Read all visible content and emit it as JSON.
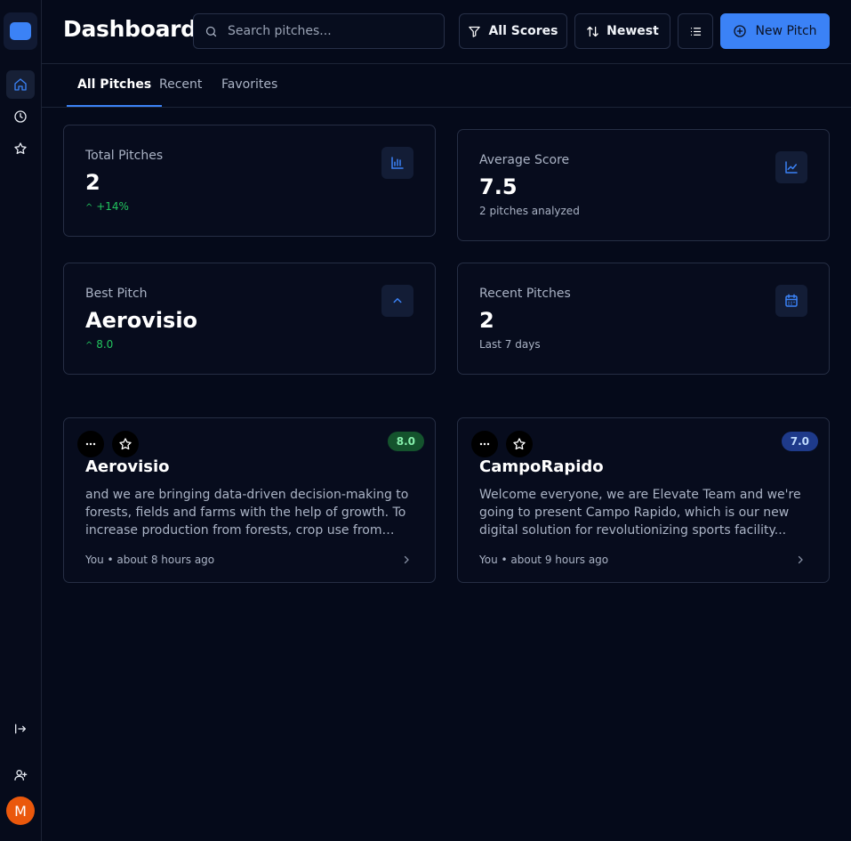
{
  "app": {
    "avatar_initial": "M"
  },
  "header": {
    "title": "Dashboard",
    "search_placeholder": "Search pitches...",
    "filter_label": "All Scores",
    "sort_label": "Newest",
    "new_pitch_label": "New Pitch"
  },
  "tabs": [
    {
      "label": "All Pitches",
      "active": true
    },
    {
      "label": "Recent",
      "active": false
    },
    {
      "label": "Favorites",
      "active": false
    }
  ],
  "stats": {
    "total": {
      "label": "Total Pitches",
      "value": "2",
      "sub": "+14%",
      "icon": "bar-chart-icon"
    },
    "average": {
      "label": "Average Score",
      "value": "7.5",
      "sub": "2 pitches analyzed",
      "icon": "line-chart-icon"
    },
    "best": {
      "label": "Best Pitch",
      "value": "Aerovisio",
      "sub": "8.0",
      "icon": "chevron-up-icon"
    },
    "recent": {
      "label": "Recent Pitches",
      "value": "2",
      "sub": "Last 7 days",
      "icon": "calendar-icon"
    }
  },
  "pitches": [
    {
      "title": "Aerovisio",
      "score": "8.0",
      "description": "and we are bringing data-driven decision-making to forests, fields and farms with the help of growth. To increase production from forests, crop use from farms...",
      "meta": "You • about 8 hours ago"
    },
    {
      "title": "CampoRapido",
      "score": "7.0",
      "description": "Welcome everyone, we are Elevate Team and we're going to present Campo Rapido, which is our new digital solution for revolutionizing sports facility...",
      "meta": "You • about 9 hours ago"
    }
  ],
  "colors": {
    "accent": "#3b82f6",
    "background": "#050a1a",
    "positive": "#22c55e",
    "badge_green_bg": "#14532d",
    "badge_blue_bg": "#1e3a8a"
  }
}
